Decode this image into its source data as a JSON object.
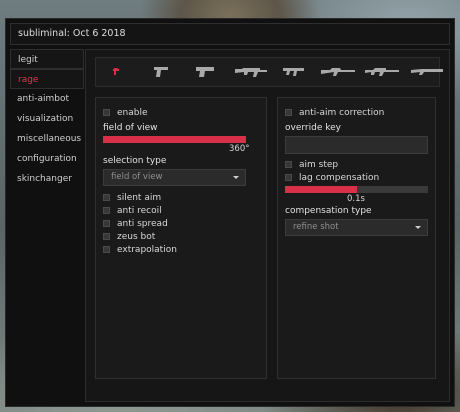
{
  "window": {
    "title": "subliminal: Oct  6 2018"
  },
  "accent": "#d9304a",
  "sidebar": {
    "items": [
      {
        "label": "legit"
      },
      {
        "label": "rage",
        "active": true
      },
      {
        "label": "anti-aimbot"
      },
      {
        "label": "visualization"
      },
      {
        "label": "miscellaneous"
      },
      {
        "label": "configuration"
      },
      {
        "label": "skinchanger"
      }
    ]
  },
  "weapon_tabs": {
    "items": [
      {
        "icon": "knife-icon",
        "active": true
      },
      {
        "icon": "pistol-icon"
      },
      {
        "icon": "heavy-pistol-icon"
      },
      {
        "icon": "rifle-icon"
      },
      {
        "icon": "smg-icon"
      },
      {
        "icon": "sniper-rifle-icon"
      },
      {
        "icon": "auto-sniper-icon"
      },
      {
        "icon": "shotgun-icon"
      }
    ]
  },
  "left_panel": {
    "enable_label": "enable",
    "fov_label": "field of view",
    "fov_value": "360°",
    "fov_fraction": 1.0,
    "selection_type_label": "selection type",
    "selection_type_value": "field of view",
    "options": [
      {
        "label": "silent aim"
      },
      {
        "label": "anti recoil"
      },
      {
        "label": "anti spread"
      },
      {
        "label": "zeus bot"
      },
      {
        "label": "extrapolation"
      }
    ]
  },
  "right_panel": {
    "anti_aim_correction_label": "anti-aim correction",
    "override_key_label": "override key",
    "aim_step_label": "aim step",
    "lag_compensation_label": "lag compensation",
    "lag_value": "0.1s",
    "lag_fraction": 0.5,
    "compensation_type_label": "compensation type",
    "compensation_type_value": "refine shot"
  }
}
